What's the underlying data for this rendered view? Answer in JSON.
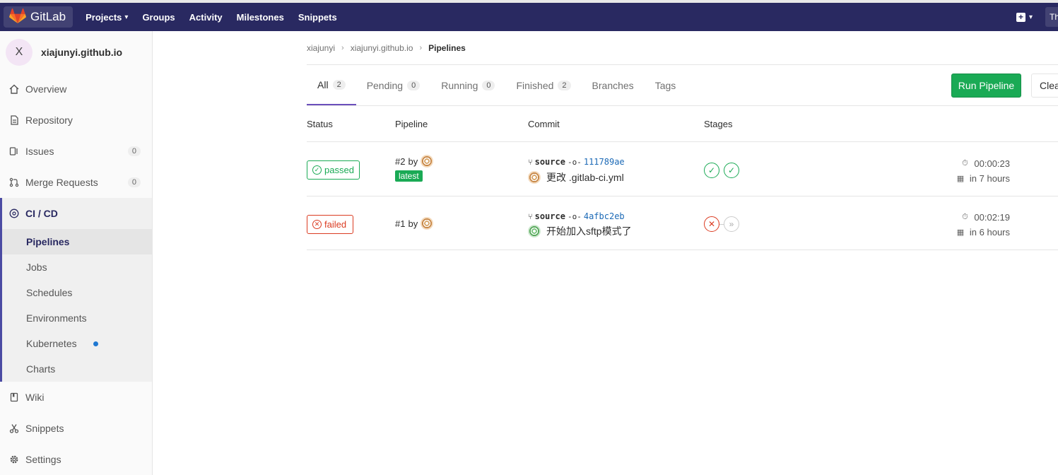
{
  "nav": {
    "brand": "GitLab",
    "links": [
      "Projects",
      "Groups",
      "Activity",
      "Milestones",
      "Snippets"
    ],
    "projects_caret": "⌄",
    "plus_caret": "⌄",
    "user_initials": "Th"
  },
  "sidebar": {
    "avatar_letter": "X",
    "project_name": "xiajunyi.github.io",
    "items": [
      {
        "label": "Overview"
      },
      {
        "label": "Repository"
      },
      {
        "label": "Issues",
        "count": "0"
      },
      {
        "label": "Merge Requests",
        "count": "0"
      },
      {
        "label": "CI / CD"
      }
    ],
    "cicd_sub": [
      "Pipelines",
      "Jobs",
      "Schedules",
      "Environments",
      "Kubernetes",
      "Charts"
    ],
    "bottom": [
      {
        "label": "Wiki"
      },
      {
        "label": "Snippets"
      },
      {
        "label": "Settings"
      }
    ]
  },
  "breadcrumb": [
    "xiajunyi",
    "xiajunyi.github.io",
    "Pipelines"
  ],
  "tabs": [
    {
      "label": "All",
      "count": "2"
    },
    {
      "label": "Pending",
      "count": "0"
    },
    {
      "label": "Running",
      "count": "0"
    },
    {
      "label": "Finished",
      "count": "2"
    },
    {
      "label": "Branches"
    },
    {
      "label": "Tags"
    }
  ],
  "buttons": {
    "run_pipeline": "Run Pipeline",
    "clear": "Clear"
  },
  "table": {
    "headers": [
      "Status",
      "Pipeline",
      "Commit",
      "Stages"
    ],
    "rows": [
      {
        "status": "passed",
        "pipeline_id": "#2",
        "by": "by",
        "tag": "latest",
        "branch": "source",
        "sha": "111789ae",
        "message": "更改 .gitlab-ci.yml",
        "duration": "00:00:23",
        "finished": "in 7 hours"
      },
      {
        "status": "failed",
        "pipeline_id": "#1",
        "by": "by",
        "branch": "source",
        "sha": "4afbc2eb",
        "message": "开始加入sftp模式了",
        "duration": "00:02:19",
        "finished": "in 6 hours"
      }
    ]
  },
  "colors": {
    "navbar": "#292961",
    "success": "#1aaa55",
    "failed": "#db3b21",
    "link": "#1b69b6"
  }
}
